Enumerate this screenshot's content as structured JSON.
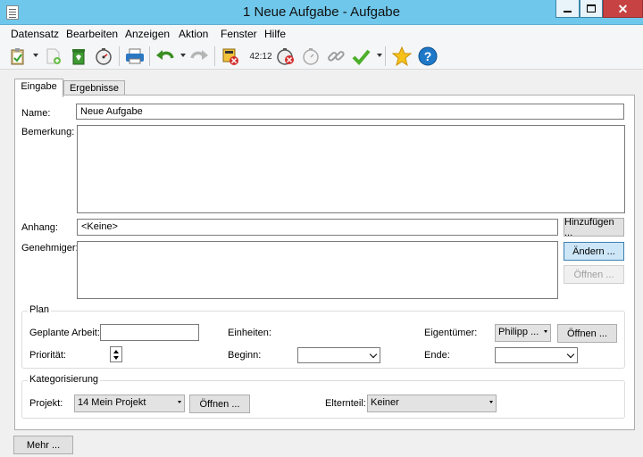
{
  "window": {
    "title": "1 Neue Aufgabe - Aufgabe"
  },
  "menu": [
    "Datensatz",
    "Bearbeiten",
    "Anzeigen",
    "Aktion",
    "Fenster",
    "Hilfe"
  ],
  "toolbar": {
    "timer": "42:12"
  },
  "tabs": [
    "Eingabe",
    "Ergebnisse"
  ],
  "form": {
    "name_label": "Name:",
    "name_value": "Neue Aufgabe",
    "remark_label": "Bemerkung:",
    "remark_value": "",
    "attachment_label": "Anhang:",
    "attachment_value": "<Keine>",
    "add_button": "Hinzufügen ...",
    "approver_label": "Genehmiger:",
    "change_button": "Ändern ...",
    "open_disabled_button": "Öffnen ..."
  },
  "plan": {
    "legend": "Plan",
    "planned_work_label": "Geplante Arbeit:",
    "planned_work_value": "",
    "units_label": "Einheiten:",
    "owner_label": "Eigentümer:",
    "owner_value": "Philipp ...",
    "owner_open_button": "Öffnen ...",
    "priority_label": "Priorität:",
    "start_label": "Beginn:",
    "start_value": "",
    "end_label": "Ende:",
    "end_value": ""
  },
  "categorization": {
    "legend": "Kategorisierung",
    "project_label": "Projekt:",
    "project_value": "14 Mein Projekt",
    "project_open_button": "Öffnen ...",
    "parent_label": "Elternteil:",
    "parent_value": "Keiner"
  },
  "footer": {
    "more_button": "Mehr ..."
  }
}
